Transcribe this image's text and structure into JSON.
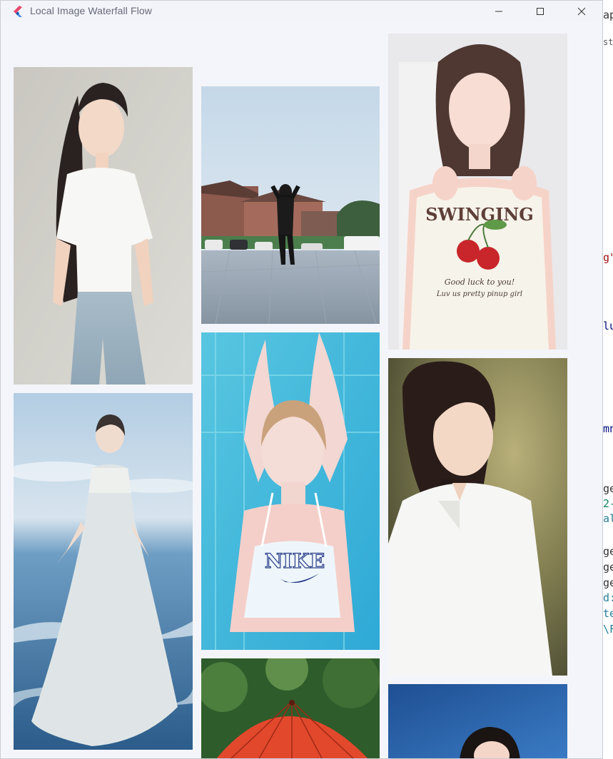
{
  "window": {
    "title": "Local Image Waterfall Flow",
    "app_icon": "flutter-logo-icon",
    "controls": [
      "minimize-icon",
      "maximize-icon",
      "close-icon"
    ]
  },
  "gallery": {
    "layout": "waterfall",
    "columns": 3,
    "items": [
      {
        "name": "photo-white-tshirt-jeans",
        "column": 1
      },
      {
        "name": "photo-ocean-gown",
        "column": 1
      },
      {
        "name": "photo-jumping-plaza",
        "column": 2
      },
      {
        "name": "photo-neon-nike-top",
        "column": 2
      },
      {
        "name": "photo-red-parasol",
        "column": 2
      },
      {
        "name": "photo-swinging-cherry-top",
        "column": 3
      },
      {
        "name": "photo-white-shirt-braid",
        "column": 3
      },
      {
        "name": "photo-blue-background",
        "column": 3
      }
    ]
  },
  "photo_text": {
    "shirt_word": "SWINGING",
    "shirt_line1": "Good luck to you!",
    "shirt_line2": "Luv us pretty pinup girl",
    "nike_word": "NIKE"
  },
  "background_editor": {
    "fragments": [
      "ap",
      "sto",
      "g\"",
      "lu",
      "mn",
      "ge",
      "2-",
      "al",
      "ge",
      "ge",
      "ge",
      "d:",
      "te",
      "\\F"
    ]
  },
  "colors": {
    "window_bg": "#f4f5fa",
    "titlebar_bg": "#f3f4f9",
    "title_text": "#666a78"
  }
}
